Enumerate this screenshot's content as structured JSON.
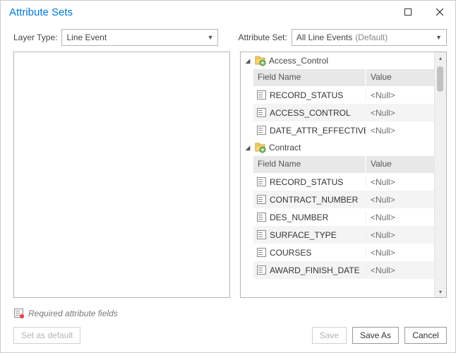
{
  "title": "Attribute Sets",
  "controls": {
    "layer_type_label": "Layer Type:",
    "layer_type_value": "Line Event",
    "attribute_set_label": "Attribute Set:",
    "attribute_set_value": "All Line Events",
    "attribute_set_default_tag": "(Default)"
  },
  "headers": {
    "field_name": "Field Name",
    "value": "Value"
  },
  "groups": [
    {
      "name": "Access_Control",
      "fields": [
        {
          "name": "RECORD_STATUS",
          "value": "<Null>"
        },
        {
          "name": "ACCESS_CONTROL",
          "value": "<Null>"
        },
        {
          "name": "DATE_ATTR_EFFECTIVE",
          "value": "<Null>"
        }
      ]
    },
    {
      "name": "Contract",
      "fields": [
        {
          "name": "RECORD_STATUS",
          "value": "<Null>"
        },
        {
          "name": "CONTRACT_NUMBER",
          "value": "<Null>"
        },
        {
          "name": "DES_NUMBER",
          "value": "<Null>"
        },
        {
          "name": "SURFACE_TYPE",
          "value": "<Null>"
        },
        {
          "name": "COURSES",
          "value": "<Null>"
        },
        {
          "name": "AWARD_FINISH_DATE",
          "value": "<Null>"
        }
      ]
    }
  ],
  "footer": {
    "hint": "Required attribute fields",
    "set_as_default": "Set as default",
    "save": "Save",
    "save_as": "Save As",
    "cancel": "Cancel"
  }
}
